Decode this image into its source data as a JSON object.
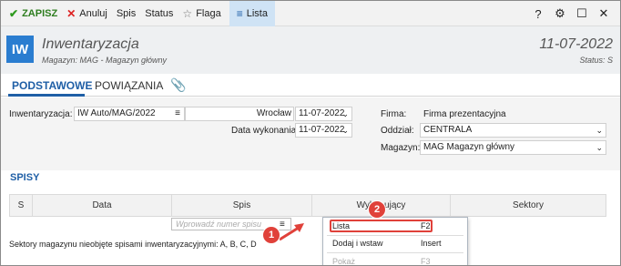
{
  "toolbar": {
    "save": "ZAPISZ",
    "cancel": "Anuluj",
    "spis": "Spis",
    "status": "Status",
    "flag": "Flaga",
    "lista": "Lista",
    "help_icon": "question-icon",
    "settings_icon": "gear-icon",
    "maximize_icon": "maximize-icon",
    "close_icon": "close-icon"
  },
  "header": {
    "logo": "IW",
    "title": "Inwentaryzacja",
    "subtitle": "Magazyn: MAG - Magazyn główny",
    "date": "11-07-2022",
    "status": "Status: S"
  },
  "tabs": {
    "items": [
      "PODSTAWOWE",
      "POWIĄZANIA"
    ],
    "attachment_icon": "paperclip-icon"
  },
  "form": {
    "inwentaryzacja_label": "Inwentaryzacja:",
    "inwentaryzacja_value": "IW Auto/MAG/2022",
    "place_label": "Wrocław",
    "place_date": "11-07-2022",
    "exec_label": "Data wykonania:",
    "exec_date": "11-07-2022",
    "firma_label": "Firma:",
    "firma_value": "Firma prezentacyjna",
    "oddzial_label": "Oddział:",
    "oddzial_value": "CENTRALA",
    "magazyn_label": "Magazyn:",
    "magazyn_value": "MAG  Magazyn główny"
  },
  "section": {
    "title": "SPISY",
    "columns": [
      "S",
      "Data",
      "Spis",
      "Wykonujący",
      "Sektory"
    ],
    "input_placeholder": "Wprowadź numer spisu",
    "footnote": "Sektory magazynu nieobjęte spisami inwentaryzacyjnymi: A, B, C, D"
  },
  "menu": {
    "items": [
      {
        "label": "Lista",
        "shortcut": "F2",
        "enabled": true
      },
      {
        "label": "Dodaj i wstaw",
        "shortcut": "Insert",
        "enabled": true
      },
      {
        "label": "Pokaż",
        "shortcut": "F3",
        "enabled": false
      }
    ]
  },
  "callouts": [
    "1",
    "2"
  ],
  "colors": {
    "accent": "#1f5fa6",
    "logo_bg": "#2a7dd0",
    "save_green": "#2e9a1f",
    "callout_red": "#e0413a",
    "toolbar_lista_bg": "#cfe3f5"
  }
}
